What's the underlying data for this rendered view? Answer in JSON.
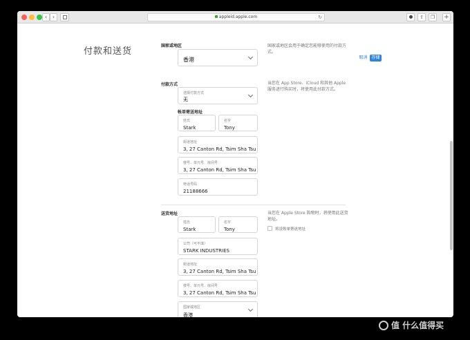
{
  "browser": {
    "url": "appleid.apple.com",
    "nav_back": "‹",
    "nav_forward": "›",
    "reload": "↻",
    "add_tab": "+"
  },
  "page": {
    "title": "付款和送货",
    "cancel_label": "取消",
    "save_label": "存储"
  },
  "region_section": {
    "label": "国家或地区",
    "value": "香港",
    "note": "国家或地区会用于确定您能够使用的付款方式。"
  },
  "payment_section": {
    "label": "付款方式",
    "select_caption": "选择付款方式",
    "select_value": "无",
    "note": "当您在 App Store、iCloud 和其他 Apple 服务进行购买时，将使用此付款方式。"
  },
  "billing_section": {
    "label": "帐单寄送地址",
    "last_name_caption": "姓氏",
    "last_name": "Stark",
    "first_name_caption": "名字",
    "first_name": "Tony",
    "street_caption": "街道地址",
    "street": "3, 27 Canton Rd, Tsim Sha Tsu",
    "unit_caption": "楼号、单元号、房间号",
    "unit": "3, 27 Canton Rd, Tsim Sha Tsu",
    "phone_caption": "电话号码",
    "phone": "21188666"
  },
  "shipping_section": {
    "label": "送货地址",
    "note": "当您在 Apple Store 购物时，将使用此送货地址。",
    "checkbox_label": "将设账单寄送地址",
    "last_name_caption": "姓氏",
    "last_name": "Stark",
    "first_name_caption": "名字",
    "first_name": "Tony",
    "company_caption": "公司（可不填）",
    "company": "STARK INDUSTRIES",
    "street_caption": "街道地址",
    "street": "3, 27 Canton Rd, Tsim Sha Tsu",
    "unit_caption": "楼号、单元号、房间号",
    "unit": "3, 27 Canton Rd, Tsim Sha Tsu",
    "country_caption": "国家或地区",
    "country": "香港"
  },
  "watermark": {
    "text": "值 什么值得买"
  },
  "colors": {
    "accent": "#2f82e0",
    "window_bg": "#ffffff",
    "outer_bg": "#000000"
  }
}
